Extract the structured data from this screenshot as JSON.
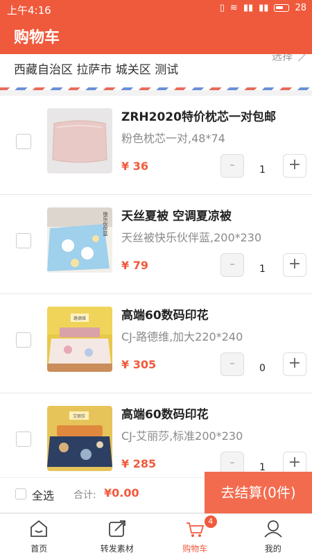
{
  "status_bar": {
    "time": "上午4:16",
    "battery": "28"
  },
  "header": {
    "title": "购物车"
  },
  "address": {
    "text": "西藏自治区 拉萨市 城关区 测试",
    "select_label": "选择"
  },
  "cart": {
    "items": [
      {
        "name": "ZRH2020特价枕芯一对包邮",
        "spec": "粉色枕芯一对,48*74",
        "price": "¥ 36",
        "qty": "1"
      },
      {
        "name": "天丝夏被 空调夏凉被",
        "spec": "天丝被快乐伙伴蓝,200*230",
        "price": "¥ 79",
        "qty": "1",
        "image_text": "快乐伙伴蓝"
      },
      {
        "name": "高端60数码印花",
        "spec": "CJ-路德维,加大220*240",
        "price": "¥ 305",
        "qty": "0",
        "image_text": "路德维"
      },
      {
        "name": "高端60数码印花",
        "spec": "CJ-艾丽莎,标准200*230",
        "price": "¥ 285",
        "qty": "1",
        "image_text": "艾丽莎"
      }
    ],
    "minus_label": "-",
    "plus_label": "+"
  },
  "footer": {
    "select_all": "全选",
    "total_label": "合计:",
    "total_value": "¥0.00",
    "checkout_label": "去结算(0件)"
  },
  "tabbar": {
    "tabs": [
      {
        "label": "首页",
        "icon": "home-icon"
      },
      {
        "label": "转发素材",
        "icon": "share-icon"
      },
      {
        "label": "购物车",
        "icon": "cart-icon",
        "badge": "4",
        "active": true
      },
      {
        "label": "我的",
        "icon": "user-icon"
      }
    ]
  },
  "colors": {
    "accent": "#f05a3c",
    "checkout": "#f36b4e"
  }
}
